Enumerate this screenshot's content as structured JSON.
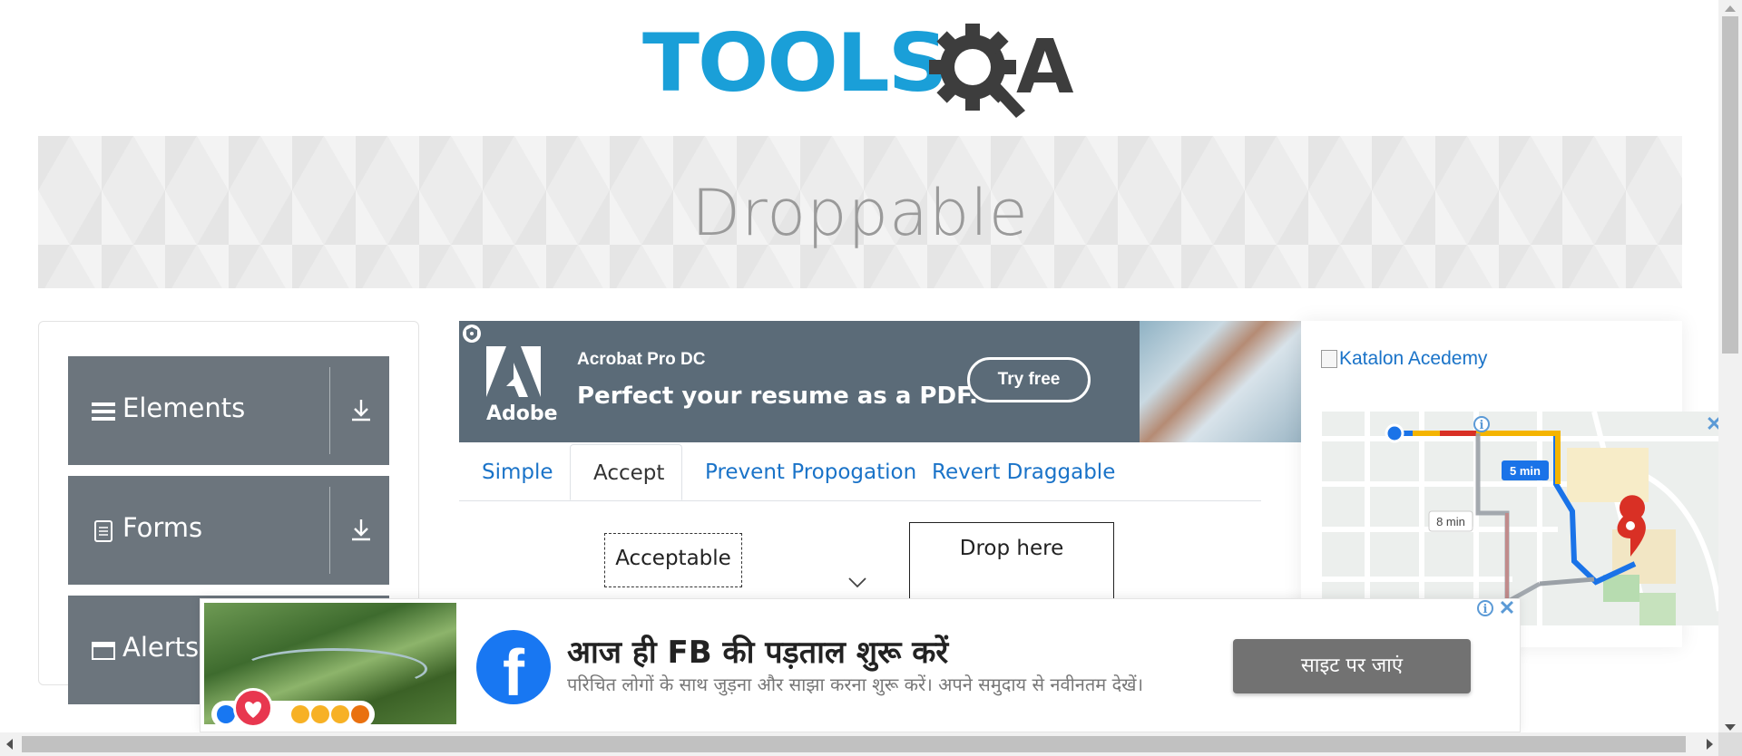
{
  "logo": {
    "tools_text": "TOOLS",
    "a_text": "A",
    "colors": {
      "tools": "#1a9fd8",
      "qa": "#3d3d3d"
    }
  },
  "page": {
    "title": "Droppable"
  },
  "sidebar": {
    "groups": [
      {
        "label": "Elements",
        "icon": "hamburger-icon"
      },
      {
        "label": "Forms",
        "icon": "document-icon"
      },
      {
        "label": "Alerts",
        "icon": "window-icon"
      }
    ]
  },
  "ad_top": {
    "brand": "Adobe",
    "product": "Acrobat Pro DC",
    "headline": "Perfect your resume as a PDF.",
    "cta": "Try free"
  },
  "tabs": [
    {
      "label": "Simple",
      "active": false
    },
    {
      "label": "Accept",
      "active": true
    },
    {
      "label": "Prevent Propogation",
      "active": false
    },
    {
      "label": "Revert Draggable",
      "active": false
    }
  ],
  "accept_tab": {
    "draggable_label": "Acceptable",
    "drop_label": "Drop here"
  },
  "ad_right": {
    "image_alt": "Katalon Acedemy",
    "map": {
      "time_primary": "5 min",
      "time_alt": "8 min"
    }
  },
  "ad_bottom": {
    "title": "आज ही FB की पड़ताल शुरू करें",
    "subtitle": "परिचित लोगों के साथ जुड़ना और साझा करना शुरू करें। अपने समुदाय से नवीनतम देखें।",
    "cta": "साइट पर जाएं",
    "fb_letter": "f"
  }
}
